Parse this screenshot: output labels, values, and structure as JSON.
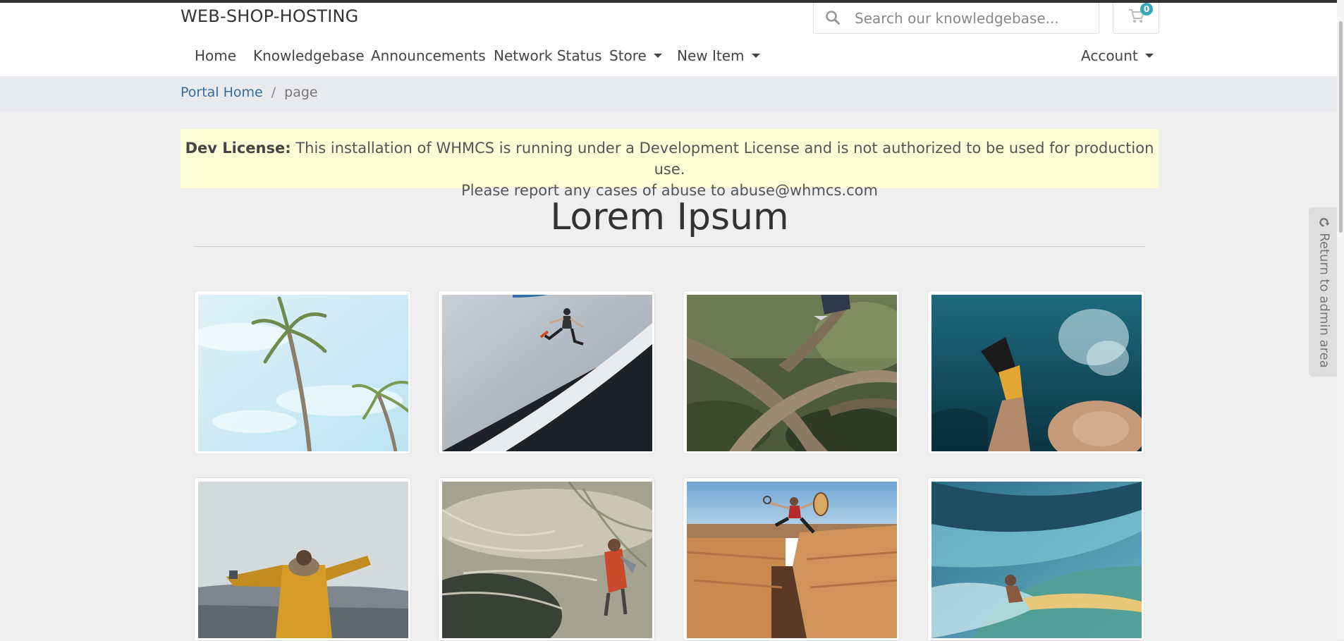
{
  "header": {
    "brand": "WEB-SHOP-HOSTING",
    "search_placeholder": "Search our knowledgebase...",
    "cart_count": "0"
  },
  "nav": {
    "items": [
      {
        "label": "Home",
        "dropdown": false
      },
      {
        "label": "Knowledgebase",
        "dropdown": false
      },
      {
        "label": "Announcements",
        "dropdown": false
      },
      {
        "label": "Network Status",
        "dropdown": false
      },
      {
        "label": "Store",
        "dropdown": true
      },
      {
        "label": "New Item",
        "dropdown": true
      }
    ],
    "account": {
      "label": "Account",
      "dropdown": true
    }
  },
  "breadcrumb": {
    "home": "Portal Home",
    "separator": "/",
    "current": "page"
  },
  "notice": {
    "strong": "Dev License:",
    "text": "This installation of WHMCS is running under a Development License and is not authorized to be used for production use.",
    "line2": "Please report any cases of abuse to abuse@whmcs.com"
  },
  "page_title": "Lorem Ipsum",
  "gallery": [
    {
      "subject": "palm trees against sky"
    },
    {
      "subject": "person jumping on white slope"
    },
    {
      "subject": "person climbing tree branches"
    },
    {
      "subject": "legs with flippers underwater"
    },
    {
      "subject": "person in yellow coat by the sea"
    },
    {
      "subject": "person in red jacket in dune grass"
    },
    {
      "subject": "person leaping over canyon"
    },
    {
      "subject": "surfer inside wave"
    }
  ],
  "admin": {
    "label": "Return to admin area"
  },
  "colors": {
    "accent": "#36a9b7",
    "link": "#356b9e",
    "notice_bg": "#fefcd6",
    "breadcrumb_bg": "#e8eaed"
  }
}
